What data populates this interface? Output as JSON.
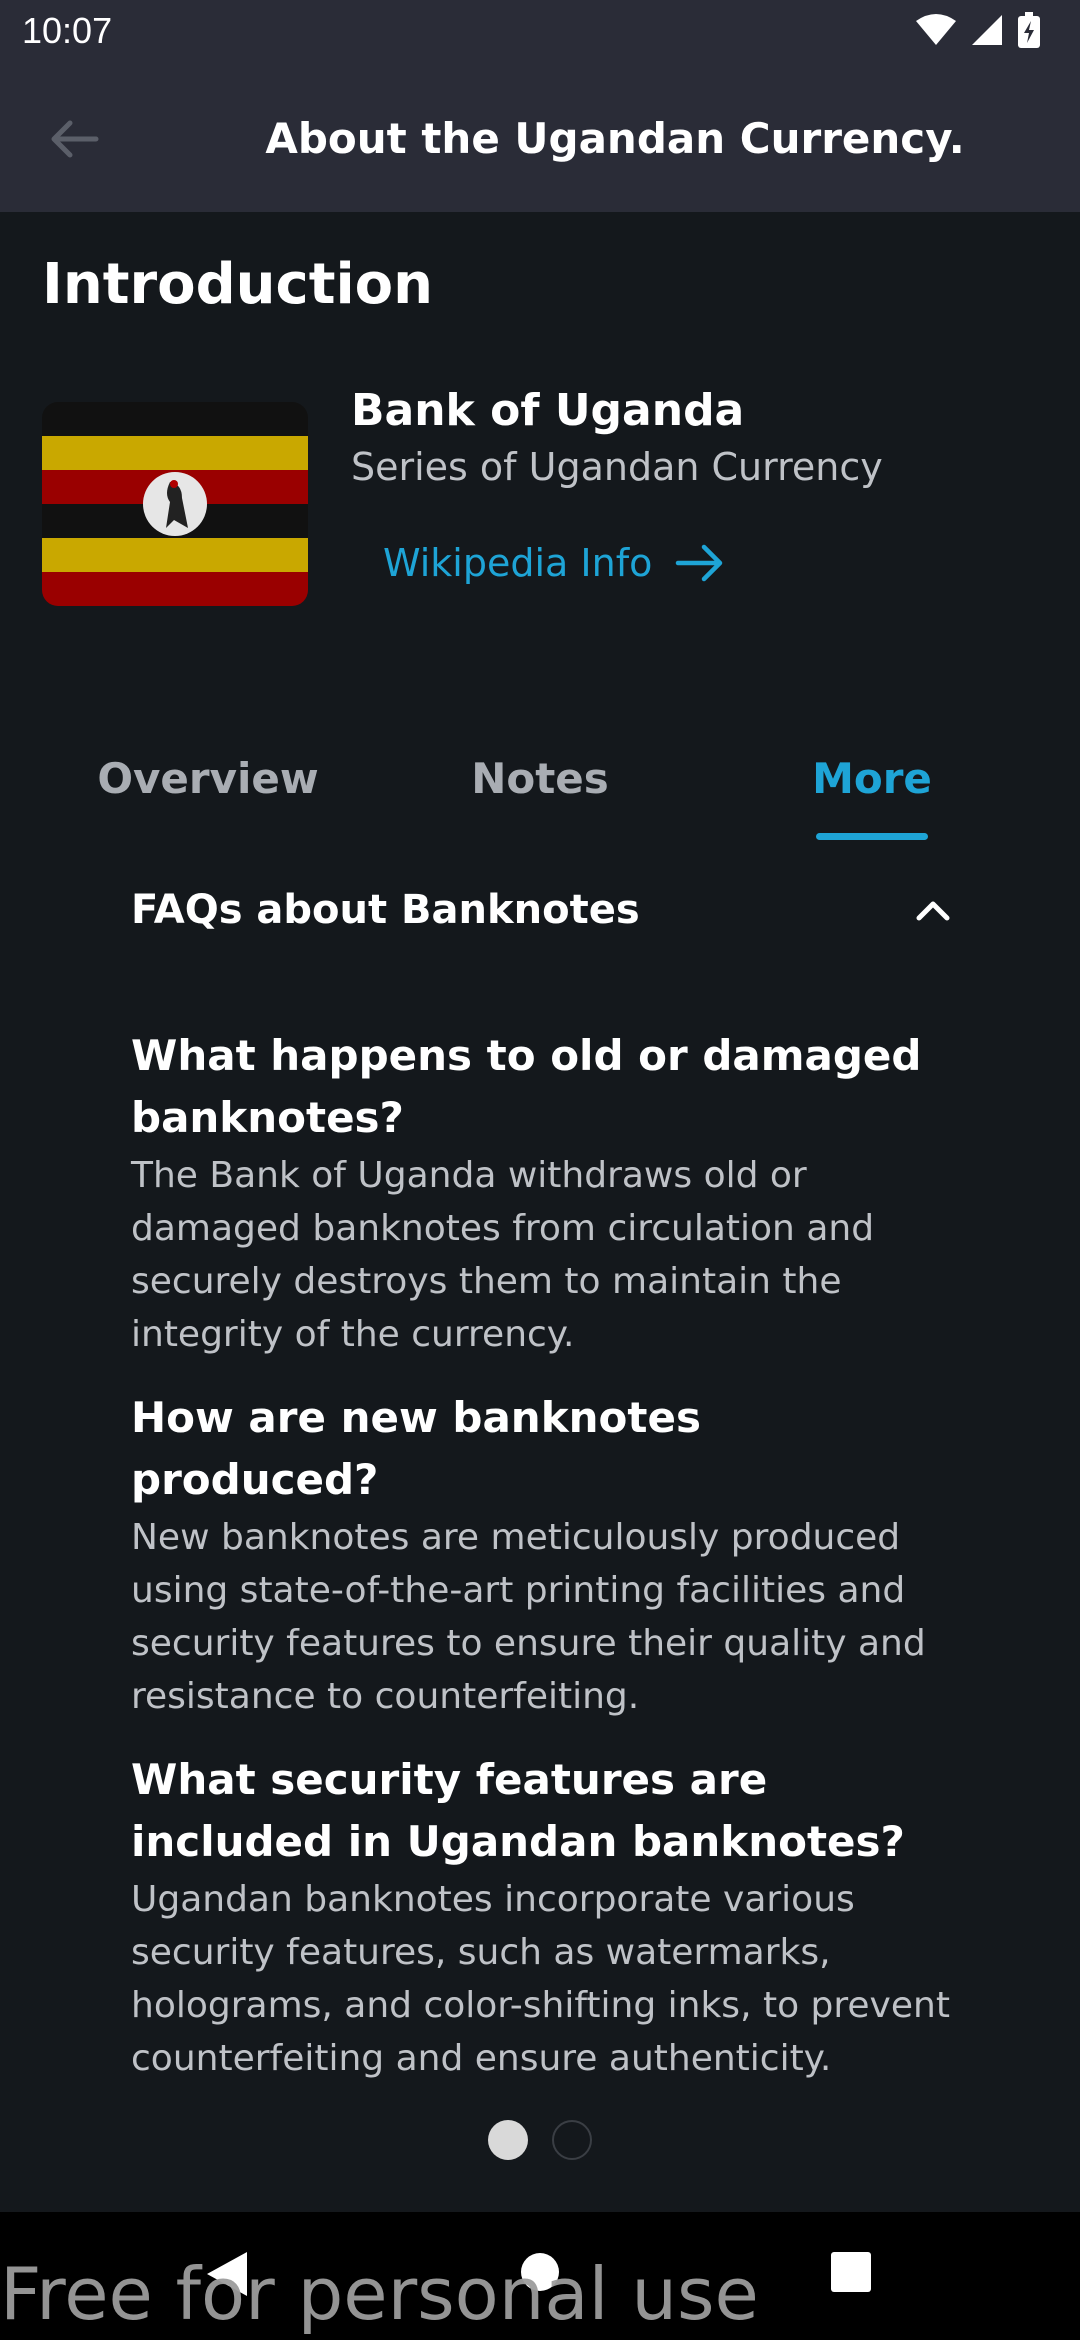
{
  "status_bar": {
    "time": "10:07",
    "icons": [
      "wifi-icon",
      "cellular-signal-icon",
      "battery-charging-icon"
    ]
  },
  "app_bar": {
    "title": "About the Ugandan Currency.",
    "back_icon": "arrow-left-icon"
  },
  "intro": {
    "section_title": "Introduction",
    "bank_name": "Bank of Uganda",
    "subtitle": "Series of Ugandan Currency",
    "wiki_link": "Wikipedia Info",
    "wiki_icon": "arrow-right-icon"
  },
  "tabs": [
    {
      "label": "Overview",
      "active": false
    },
    {
      "label": "Notes",
      "active": false
    },
    {
      "label": "More",
      "active": true
    }
  ],
  "faq": {
    "header": "FAQs about Banknotes",
    "expanded": true,
    "items": [
      {
        "question": "What happens to old or damaged banknotes?",
        "answer": "The Bank of Uganda withdraws old or damaged banknotes from circulation and securely destroys them to maintain the integrity of the currency."
      },
      {
        "question": "How are new banknotes produced?",
        "answer": "New banknotes are meticulously produced using state-of-the-art printing facilities and security features to ensure their quality and resistance to counterfeiting."
      },
      {
        "question": "What security features are included in Ugandan banknotes?",
        "answer": "Ugandan banknotes incorporate various security features, such as watermarks, holograms, and color-shifting inks, to prevent counterfeiting and ensure authenticity."
      }
    ]
  },
  "pager": {
    "current": 1,
    "total": 2
  },
  "watermark": "Free for personal use",
  "colors": {
    "accent": "#1ea4d6",
    "background": "#14181c",
    "app_bar": "#2a2c37"
  }
}
